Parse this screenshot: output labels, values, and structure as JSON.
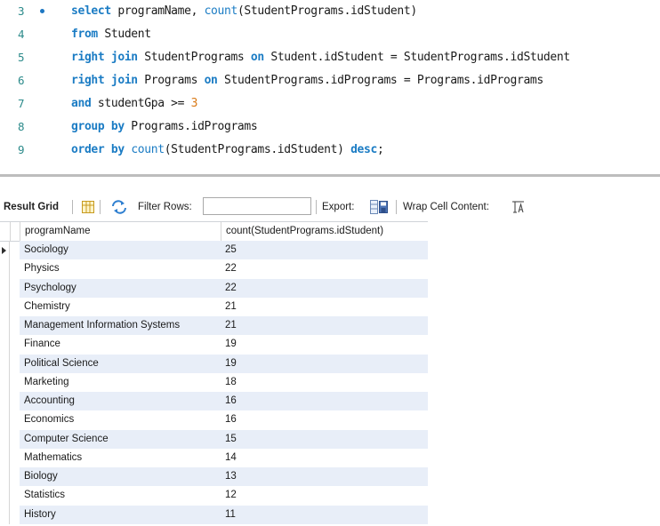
{
  "editor": {
    "lines": [
      {
        "num": "3",
        "segments": [
          [
            "kw",
            "select"
          ],
          [
            "t",
            " programName, "
          ],
          [
            "fn",
            "count"
          ],
          [
            "t",
            "(StudentPrograms.idStudent)"
          ]
        ]
      },
      {
        "num": "4",
        "segments": [
          [
            "kw",
            "from"
          ],
          [
            "t",
            " Student"
          ]
        ]
      },
      {
        "num": "5",
        "segments": [
          [
            "kw",
            "right join"
          ],
          [
            "t",
            " StudentPrograms "
          ],
          [
            "kw",
            "on"
          ],
          [
            "t",
            " Student.idStudent = StudentPrograms.idStudent"
          ]
        ]
      },
      {
        "num": "6",
        "segments": [
          [
            "kw",
            "right join"
          ],
          [
            "t",
            " Programs "
          ],
          [
            "kw",
            "on"
          ],
          [
            "t",
            " StudentPrograms.idPrograms = Programs.idPrograms"
          ]
        ]
      },
      {
        "num": "7",
        "segments": [
          [
            "kw",
            "and"
          ],
          [
            "t",
            " studentGpa >= "
          ],
          [
            "num",
            "3"
          ]
        ]
      },
      {
        "num": "8",
        "segments": [
          [
            "kw",
            "group by"
          ],
          [
            "t",
            " Programs.idPrograms"
          ]
        ]
      },
      {
        "num": "9",
        "segments": [
          [
            "kw",
            "order by"
          ],
          [
            "t",
            " "
          ],
          [
            "fn",
            "count"
          ],
          [
            "t",
            "(StudentPrograms.idStudent) "
          ],
          [
            "kw",
            "desc"
          ],
          [
            "t",
            ";"
          ]
        ]
      }
    ]
  },
  "toolbar": {
    "result_grid": "Result Grid",
    "filter_rows": "Filter Rows:",
    "filter_value": "",
    "export": "Export:",
    "wrap_cell": "Wrap Cell Content:"
  },
  "grid": {
    "headers": [
      "programName",
      "count(StudentPrograms.idStudent)"
    ],
    "rows": [
      [
        "Sociology",
        "25"
      ],
      [
        "Physics",
        "22"
      ],
      [
        "Psychology",
        "22"
      ],
      [
        "Chemistry",
        "21"
      ],
      [
        "Management Information Systems",
        "21"
      ],
      [
        "Finance",
        "19"
      ],
      [
        "Political Science",
        "19"
      ],
      [
        "Marketing",
        "18"
      ],
      [
        "Accounting",
        "16"
      ],
      [
        "Economics",
        "16"
      ],
      [
        "Computer Science",
        "15"
      ],
      [
        "Mathematics",
        "14"
      ],
      [
        "Biology",
        "13"
      ],
      [
        "Statistics",
        "12"
      ],
      [
        "History",
        "11"
      ]
    ]
  },
  "colors": {
    "keyword": "#1b7cc4",
    "number": "#d97a18",
    "line_number": "#2b8a8a",
    "row_alt": "#e8eef8"
  }
}
